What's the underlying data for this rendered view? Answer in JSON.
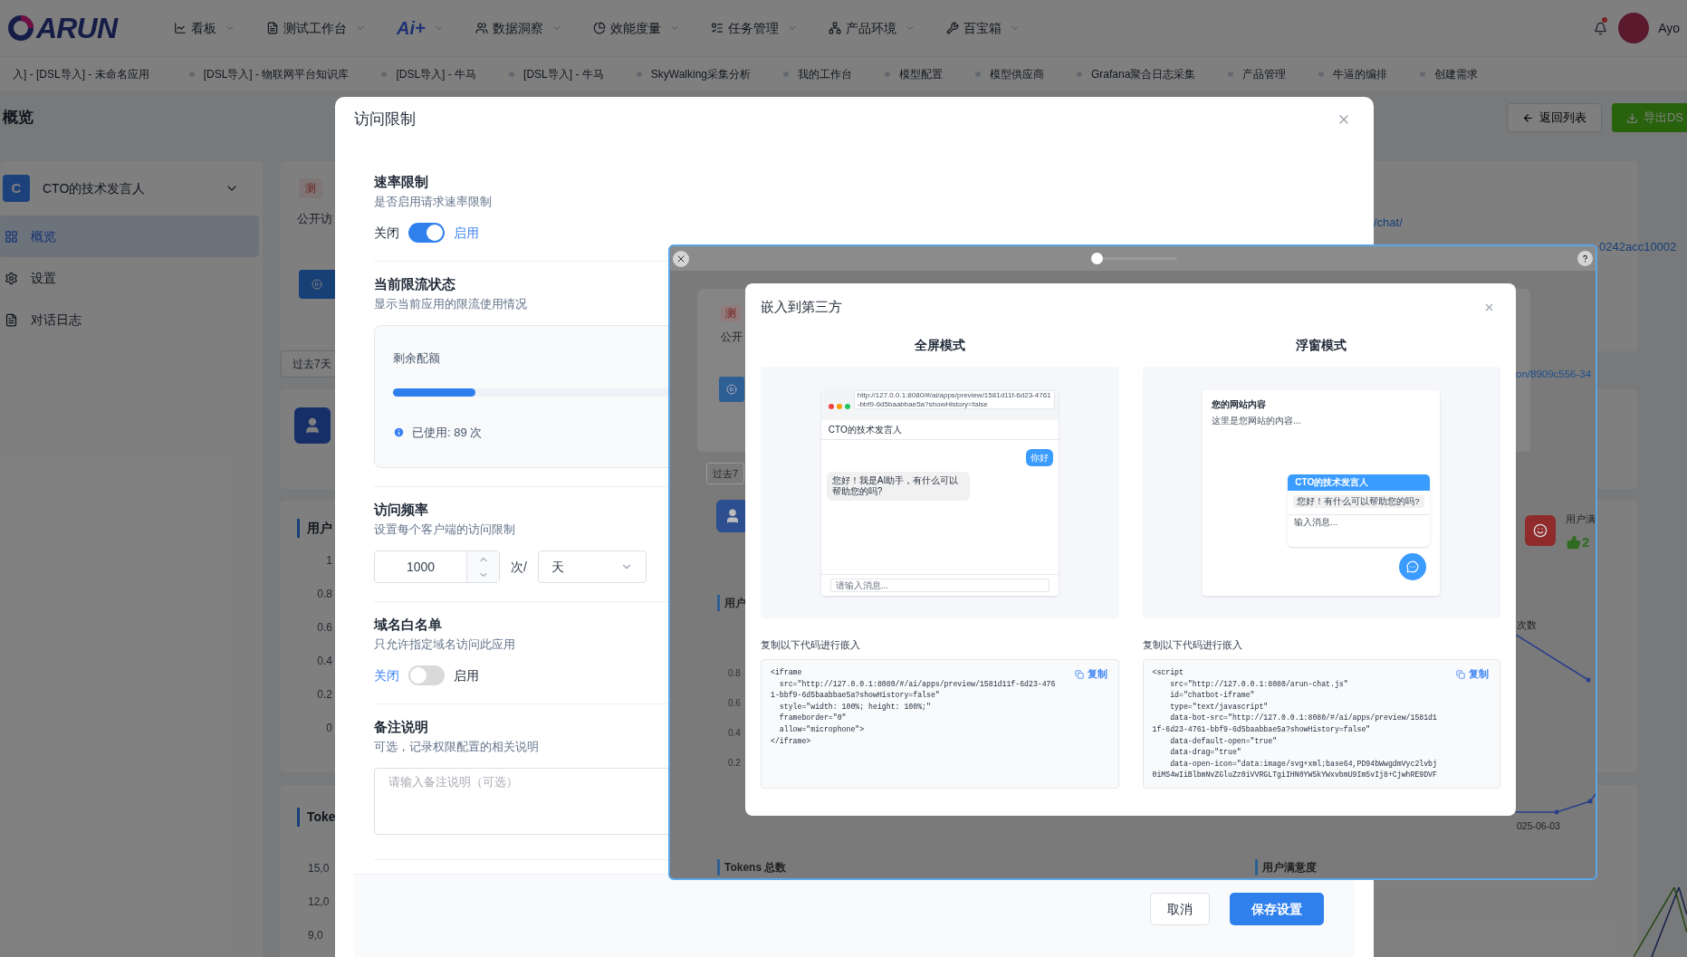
{
  "nav": {
    "logo": "ARUN",
    "menus": [
      {
        "label": "看板",
        "kind": "menu"
      },
      {
        "label": "测试工作台",
        "kind": "menu"
      },
      {
        "label": "Ai+",
        "kind": "brand"
      },
      {
        "label": "数据洞察",
        "kind": "menu"
      },
      {
        "label": "效能度量",
        "kind": "menu"
      },
      {
        "label": "任务管理",
        "kind": "menu"
      },
      {
        "label": "产品环境",
        "kind": "menu"
      },
      {
        "label": "百宝箱",
        "kind": "menu"
      }
    ],
    "has_notification": true,
    "user": "Ayo"
  },
  "tabs": [
    {
      "label": "入] - [DSL导入] - 未命名应用",
      "selected": false,
      "partial": true
    },
    {
      "label": "[DSL导入] - 物联网平台知识库",
      "selected": false,
      "partial": false
    },
    {
      "label": "[DSL导入] - 牛马",
      "selected": false,
      "partial": false
    },
    {
      "label": "[DSL导入] - 牛马",
      "selected": false,
      "partial": false
    },
    {
      "label": "SkyWalking采集分析",
      "selected": false,
      "partial": false
    },
    {
      "label": "我的工作台",
      "selected": false,
      "partial": false
    },
    {
      "label": "模型配置",
      "selected": false,
      "partial": false
    },
    {
      "label": "模型供应商",
      "selected": false,
      "partial": false
    },
    {
      "label": "Grafana聚合日志采集",
      "selected": false,
      "partial": false
    },
    {
      "label": "产品管理",
      "selected": false,
      "partial": false
    },
    {
      "label": "牛逼的编排",
      "selected": false,
      "partial": false
    },
    {
      "label": "创建需求",
      "selected": false,
      "partial": false
    }
  ],
  "page": {
    "title": "概览",
    "buttons": [
      {
        "label": "返回列表",
        "kind": "back"
      },
      {
        "label": "导出DS",
        "kind": "export"
      }
    ]
  },
  "sidebar": {
    "app_initial": "C",
    "app_name": "CTO的技术发言人",
    "items": [
      {
        "label": "概览",
        "selected": true
      },
      {
        "label": "设置",
        "selected": false
      },
      {
        "label": "对话日志",
        "selected": false
      }
    ]
  },
  "background": {
    "tag": "测",
    "visibility": "公开访",
    "range": "过去7天",
    "users_title": "用户",
    "ticks": [
      "1",
      "0.8",
      "0.6",
      "0.4",
      "0.2",
      "0"
    ],
    "tokens_title": "Toke",
    "token_ticks": [
      "15,0",
      "12,0",
      "9,0"
    ],
    "chat_link": "/chat/",
    "app_link": "0242acc10002"
  },
  "access_modal": {
    "title": "访问限制",
    "rate_limit": {
      "title": "速率限制",
      "description": "是否启用请求速率限制",
      "off_label": "关闭",
      "on_label": "启用",
      "on": true
    },
    "status": {
      "title": "当前限流状态",
      "description": "显示当前应用的限流使用情况",
      "quota_label": "剩余配额",
      "level": 0.089,
      "used": "已使用: 89 次"
    },
    "frequency": {
      "title": "访问频率",
      "description": "设置每个客户端的访问限制",
      "count": "1000",
      "unit_label": "次/",
      "period": "天"
    },
    "whitelist": {
      "title": "域名白名单",
      "description": "只允许指定域名访问此应用",
      "off_label": "关闭",
      "on_label": "启用",
      "on": false
    },
    "notes": {
      "title": "备注说明",
      "description": "可选，记录权限配置的相关说明",
      "placeholder": "请输入备注说明（可选）"
    },
    "buttons": [
      {
        "label": "取消",
        "kind": "secondary"
      },
      {
        "label": "保存设置",
        "kind": "primary"
      }
    ]
  },
  "preview_window": {
    "zoom": {
      "level": 0
    },
    "copy": {
      "tag": "测",
      "visibility": "公开",
      "range": "过去7",
      "users_title": "用户",
      "ticks": [
        "0.8",
        "0.6",
        "0.4",
        "0.2"
      ],
      "tokens_title": "Tokens 总数",
      "satisfaction_title": "用户满意度",
      "link": "on/8909c556-34",
      "satisfaction_label": "用户满",
      "likes": "2",
      "count_label": "次数",
      "date": "025-06-03"
    },
    "embed_modal": {
      "title": "嵌入到第三方",
      "fullscreen": {
        "title": "全屏模式",
        "url": "http://127.0.0.1:8080/#/ai/apps/preview/1581d11f-6d23-4761-bbf9-6d5baabbae5a?showHistory=false",
        "app_name": "CTO的技术发言人",
        "user_message": "你好",
        "bot_message": "您好！我是AI助手，有什么可以帮助您的吗?",
        "input_placeholder": "请输入消息...",
        "copy_caption": "复制以下代码进行嵌入",
        "copy_label": "复制",
        "code": [
          "<iframe",
          "  src=\"http://127.0.0.1:8080/#/ai/apps/preview/1581d11f-6d23-476",
          "1-bbf9-6d5baabbae5a?showHistory=false\"",
          "  style=\"width: 100%; height: 100%;\"",
          "  frameborder=\"0\"",
          "  allow=\"microphone\">",
          "</iframe>"
        ]
      },
      "floating": {
        "title": "浮窗模式",
        "site_title": "您的网站内容",
        "site_text": "这里是您网站的内容...",
        "app_name": "CTO的技术发言人",
        "bot_message": "您好！有什么可以帮助您的吗?",
        "input_placeholder": "输入消息...",
        "copy_caption": "复制以下代码进行嵌入",
        "copy_label": "复制",
        "code": [
          "<script",
          "    src=\"http://127.0.0.1:8080/arun-chat.js\"",
          "    id=\"chatbot-iframe\"",
          "    type=\"text/javascript\"",
          "    data-bot-src=\"http://127.0.0.1:8080/#/ai/apps/preview/1581d1",
          "1f-6d23-4761-bbf9-6d5baabbae5a?showHistory=false\"",
          "    data-default-open=\"true\"",
          "    data-drag=\"true\"",
          "    data-open-icon=\"data:image/svg+xml;base64,PD94bWwgdmVyc2lvbj",
          "0iMS4wIiBlbmNvZGluZz0iVVRGLTgiIHN0YW5kYWxvbmU9Im5vIj8+CjwhRE9DVF"
        ]
      }
    }
  }
}
